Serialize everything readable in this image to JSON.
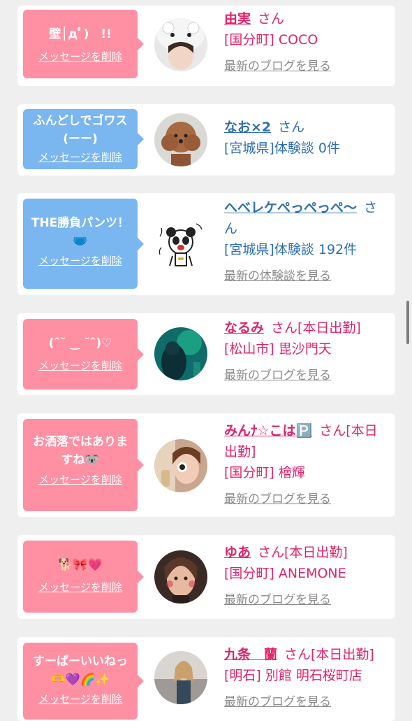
{
  "messages": [
    {
      "msg_lines": [
        "壁│дﾟ)　!!"
      ],
      "delete": "メッセージを削除",
      "name": "由実",
      "suffix": "さん",
      "location": "[国分町] COCO",
      "more": "最新のブログを見る",
      "theme": "pink"
    },
    {
      "msg_lines": [
        "ふんどしでゴワス",
        "(ーー)"
      ],
      "delete": "メッセージを削除",
      "name": "なお×2",
      "suffix": "さん",
      "location": "[宮城県]体験談 0件",
      "more": "",
      "theme": "blue"
    },
    {
      "msg_lines": [
        "THE勝負パンツ！",
        "🩲"
      ],
      "delete": "メッセージを削除",
      "name": "へべレケぺっぺっぺ〜",
      "suffix": "さん",
      "location": "[宮城県]体験談 192件",
      "more": "最新の体験談を見る",
      "theme": "blue"
    },
    {
      "msg_lines": [
        "(ˆ˘ ‿ ˘ˆ)♡"
      ],
      "delete": "メッセージを削除",
      "name": "なるみ",
      "suffix": "さん[本日出勤]",
      "location": "[松山市] 毘沙門天",
      "more": "最新のブログを見る",
      "theme": "pink"
    },
    {
      "msg_lines": [
        "お洒落ではありま",
        "すね🐨"
      ],
      "delete": "メッセージを削除",
      "name": "みんﾅ☆こは🅿️",
      "suffix": "さん[本日出勤]",
      "location": "[国分町] 檜輝",
      "more": "最新のブログを見る",
      "theme": "pink"
    },
    {
      "msg_lines": [
        "🐕🎀💗"
      ],
      "delete": "メッセージを削除",
      "name": "ゆあ",
      "suffix": "さん[本日出勤]",
      "location": "[国分町] ANEMONE",
      "more": "最新のブログを見る",
      "theme": "pink"
    },
    {
      "msg_lines": [
        "すーぱーいいねっ",
        "🫶💜🌈✨"
      ],
      "delete": "メッセージを削除",
      "name": "九条　蘭",
      "suffix": "さん[本日出勤]",
      "location": "[明石] 別館 明石桜町店",
      "more": "最新のブログを見る",
      "theme": "pink"
    }
  ]
}
